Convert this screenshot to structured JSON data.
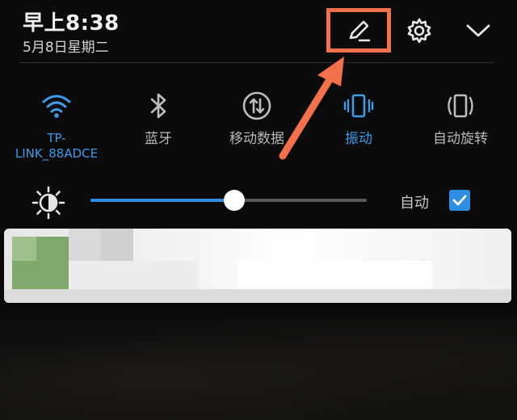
{
  "status": {
    "time": "早上8:38",
    "date": "5月8日星期二"
  },
  "header_icons": [
    "edit-icon",
    "gear-icon",
    "chevron-down-icon"
  ],
  "tiles": [
    {
      "icon": "wifi-icon",
      "label": "TP-\nLINK_88ADCE",
      "active": true
    },
    {
      "icon": "bluetooth-icon",
      "label": "蓝牙",
      "active": false
    },
    {
      "icon": "mobile-data-icon",
      "label": "移动数据",
      "active": false
    },
    {
      "icon": "vibrate-icon",
      "label": "振动",
      "active": true
    },
    {
      "icon": "auto-rotate-icon",
      "label": "自动旋转",
      "active": false
    }
  ],
  "brightness": {
    "level": 0.52,
    "auto_label": "自动",
    "auto_checked": true
  },
  "colors": {
    "accent": "#2f8ee3",
    "highlight": "#f2704a",
    "text": "#d8d8d8"
  }
}
